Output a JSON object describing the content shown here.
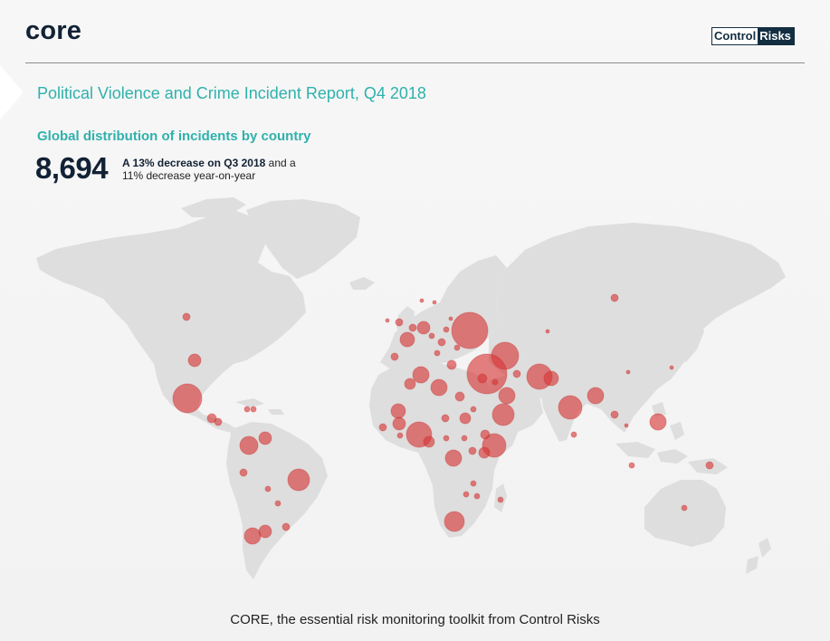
{
  "header": {
    "brand": "core",
    "partner_logo": {
      "part_a": "Control",
      "part_b": "Risks"
    }
  },
  "report": {
    "title": "Political Violence and Crime Incident Report, Q4 2018",
    "subtitle": "Global distribution of incidents by country",
    "total_incidents": "8,694",
    "change_bold": "A 13% decrease on Q3 2018",
    "change_rest_1": " and a",
    "change_rest_2": "11% decrease year-on-year"
  },
  "footer": {
    "text": "CORE, the essential risk monitoring toolkit from Control Risks"
  },
  "colors": {
    "accent": "#2fb1ac",
    "dark": "#112234",
    "bubble": "#d63535",
    "land": "#dedede"
  }
}
